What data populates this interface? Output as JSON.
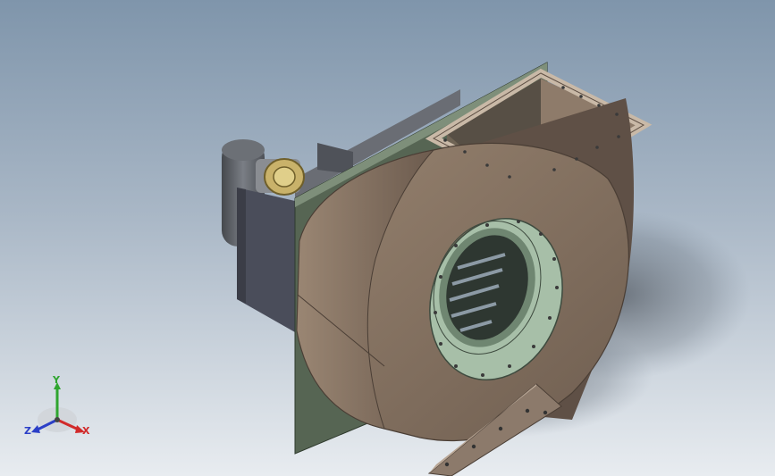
{
  "viewport": {
    "background_top": "#7f95ab",
    "background_bottom": "#e8ecf0",
    "model": {
      "name": "centrifugal-fan-assembly",
      "colors": {
        "housing": "#7d6b5c",
        "housing_dark": "#5e4f44",
        "side_plate": "#566553",
        "inlet_ring": "#a7bfa8",
        "motor": "#5a5d63",
        "flange": "#8c7a6b"
      }
    }
  },
  "triad": {
    "x_label": "X",
    "y_label": "Y",
    "z_label": "Z",
    "x_color": "#d12a2a",
    "y_color": "#2fa52f",
    "z_color": "#2b3fc7"
  }
}
